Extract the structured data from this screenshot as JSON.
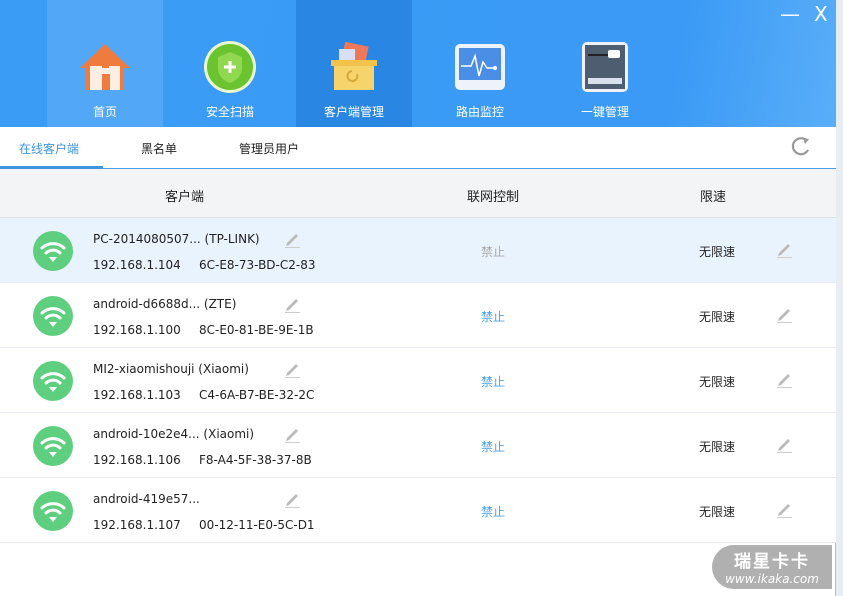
{
  "window": {
    "minimize": "—",
    "close": "X"
  },
  "nav": [
    {
      "label": "首页",
      "icon": "house-icon"
    },
    {
      "label": "安全扫描",
      "icon": "shield-icon"
    },
    {
      "label": "客户端管理",
      "icon": "box-icon"
    },
    {
      "label": "路由监控",
      "icon": "monitor-icon"
    },
    {
      "label": "一键管理",
      "icon": "router-icon"
    }
  ],
  "tabs": [
    "在线客户端",
    "黑名单",
    "管理员用户"
  ],
  "columns": {
    "client": "客户端",
    "control": "联网控制",
    "speed": "限速"
  },
  "rows": [
    {
      "name": "PC-2014080507... (TP-LINK)",
      "ip": "192.168.1.104",
      "mac": "6C-E8-73-BD-C2-83",
      "control": "禁止",
      "speed": "无限速"
    },
    {
      "name": "android-d6688d... (ZTE)",
      "ip": "192.168.1.100",
      "mac": "8C-E0-81-BE-9E-1B",
      "control": "禁止",
      "speed": "无限速"
    },
    {
      "name": "MI2-xiaomishouji  (Xiaomi)",
      "ip": "192.168.1.103",
      "mac": "C4-6A-B7-BE-32-2C",
      "control": "禁止",
      "speed": "无限速"
    },
    {
      "name": "android-10e2e4... (Xiaomi)",
      "ip": "192.168.1.106",
      "mac": "F8-A4-5F-38-37-8B",
      "control": "禁止",
      "speed": "无限速"
    },
    {
      "name": "android-419e57...",
      "ip": "192.168.1.107",
      "mac": "00-12-11-E0-5C-D1",
      "control": "禁止",
      "speed": "无限速"
    }
  ],
  "watermark": {
    "brand": "瑞星卡卡",
    "url": "www.ikaka.com"
  }
}
